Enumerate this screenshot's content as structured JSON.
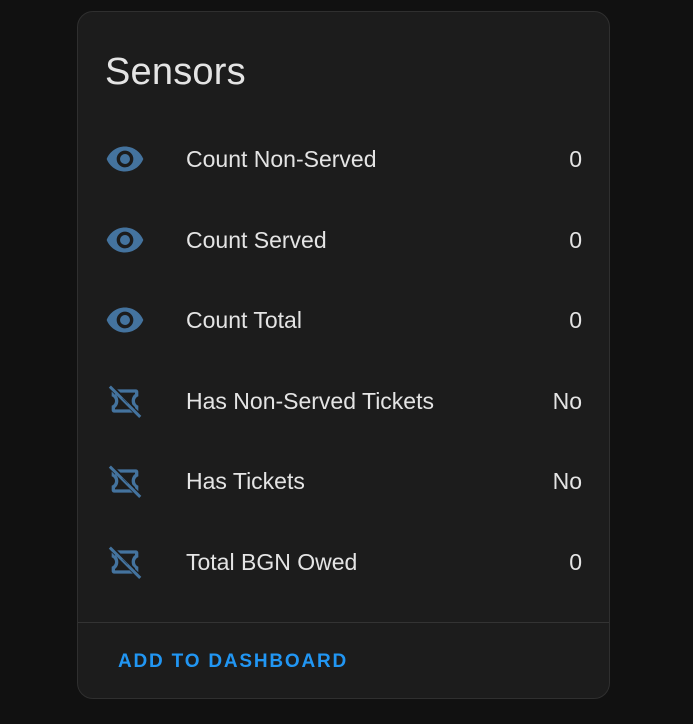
{
  "card": {
    "title": "Sensors",
    "rows": [
      {
        "icon": "eye-icon",
        "label": "Count Non-Served",
        "value": "0"
      },
      {
        "icon": "eye-icon",
        "label": "Count Served",
        "value": "0"
      },
      {
        "icon": "eye-icon",
        "label": "Count Total",
        "value": "0"
      },
      {
        "icon": "ticket-off-icon",
        "label": "Has Non-Served Tickets",
        "value": "No"
      },
      {
        "icon": "ticket-off-icon",
        "label": "Has Tickets",
        "value": "No"
      },
      {
        "icon": "ticket-off-icon",
        "label": "Total BGN Owed",
        "value": "0"
      }
    ],
    "action_label": "ADD TO DASHBOARD"
  },
  "colors": {
    "background": "#111111",
    "card": "#1c1c1c",
    "icon": "#44739e",
    "text": "#e4e4e4",
    "accent": "#2196f3"
  }
}
